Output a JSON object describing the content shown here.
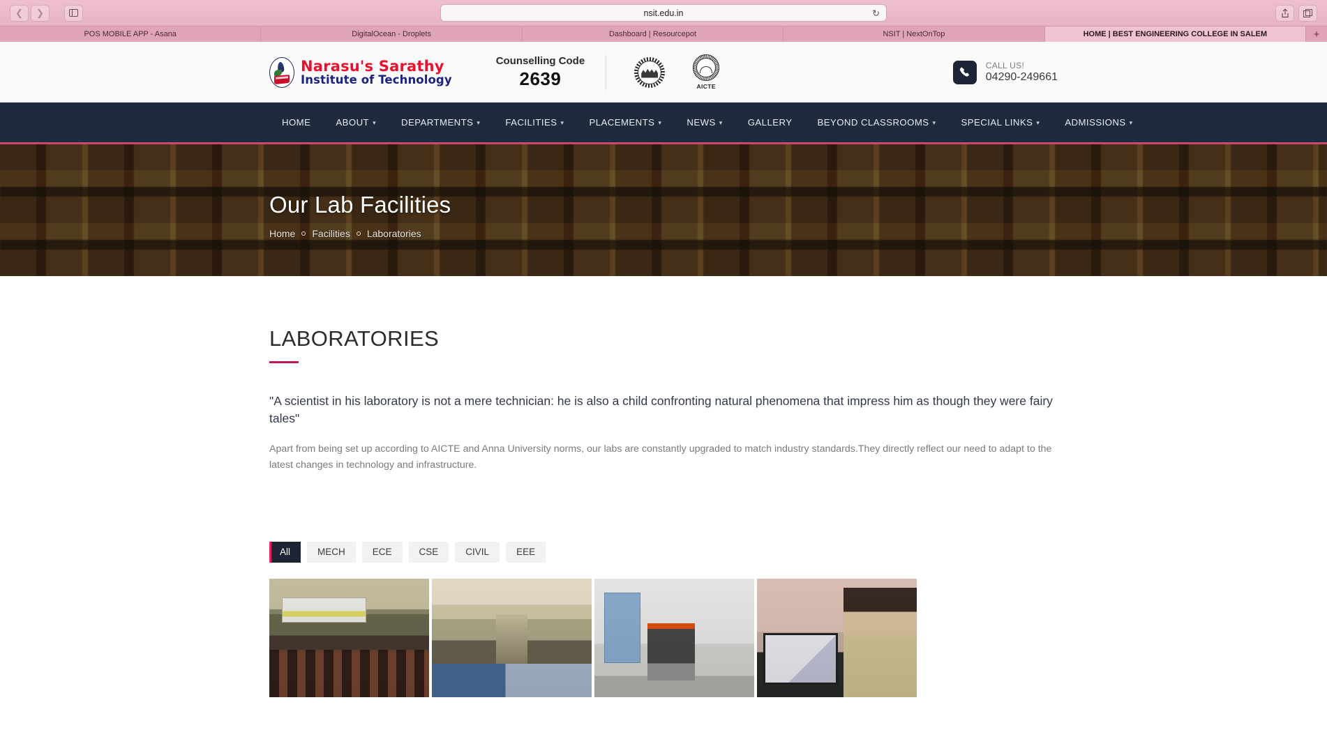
{
  "browser": {
    "url": "nsit.edu.in",
    "back_icon": "chevron-left-icon",
    "forward_icon": "chevron-right-icon",
    "sidebar_icon": "sidebar-toggle-icon",
    "reload_icon": "reload-icon",
    "share_icon": "share-icon",
    "tabs_icon": "new-tab-overview-icon",
    "new_tab_label": "+",
    "tabs": [
      {
        "label": "POS MOBILE APP - Asana",
        "active": false
      },
      {
        "label": "DigitalOcean - Droplets",
        "active": false
      },
      {
        "label": "Dashboard | Resourcepot",
        "active": false
      },
      {
        "label": "NSIT | NextOnTop",
        "active": false
      },
      {
        "label": "HOME | BEST ENGINEERING COLLEGE IN SALEM",
        "active": true
      }
    ]
  },
  "header": {
    "logo": {
      "line1": "Narasu's Sarathy",
      "line2": "Institute of Technology",
      "emblem_icon": "college-emblem-icon"
    },
    "counselling": {
      "label": "Counselling Code",
      "code": "2639"
    },
    "accreditations": [
      {
        "name": "anna-university-seal-icon",
        "caption": ""
      },
      {
        "name": "aicte-seal-icon",
        "caption": "AICTE"
      }
    ],
    "call": {
      "icon": "phone-icon",
      "label": "CALL US!",
      "number": "04290-249661"
    }
  },
  "nav": {
    "items": [
      {
        "label": "HOME",
        "has_dropdown": false
      },
      {
        "label": "ABOUT",
        "has_dropdown": true
      },
      {
        "label": "DEPARTMENTS",
        "has_dropdown": true
      },
      {
        "label": "FACILITIES",
        "has_dropdown": true
      },
      {
        "label": "PLACEMENTS",
        "has_dropdown": true
      },
      {
        "label": "NEWS",
        "has_dropdown": true
      },
      {
        "label": "GALLERY",
        "has_dropdown": false
      },
      {
        "label": "BEYOND CLASSROOMS",
        "has_dropdown": true
      },
      {
        "label": "SPECIAL LINKS",
        "has_dropdown": true
      },
      {
        "label": "ADMISSIONS",
        "has_dropdown": true
      }
    ]
  },
  "hero": {
    "title": "Our Lab Facilities",
    "breadcrumb": [
      {
        "label": "Home"
      },
      {
        "label": "Facilities"
      },
      {
        "label": "Laboratories"
      }
    ]
  },
  "main": {
    "section_title": "LABORATORIES",
    "quote": "\"A scientist in his laboratory is not a mere technician: he is also a child confronting natural phenomena that impress him as though they were fairy tales\"",
    "body": "Apart from being set up according to AICTE and Anna University norms, our labs are constantly upgraded to match industry standards.They directly reflect our need to adapt to the latest changes in technology and infrastructure.",
    "filters": [
      {
        "label": "All",
        "active": true
      },
      {
        "label": "MECH",
        "active": false
      },
      {
        "label": "ECE",
        "active": false
      },
      {
        "label": "CSE",
        "active": false
      },
      {
        "label": "CIVIL",
        "active": false
      },
      {
        "label": "EEE",
        "active": false
      }
    ],
    "gallery": [
      {
        "name": "seminar-hall-audience-photo",
        "style": "photo-hall-a"
      },
      {
        "name": "auditorium-gathering-photo",
        "style": "photo-hall-b"
      },
      {
        "name": "mechanical-engine-lab-photo",
        "style": "photo-lab-mech"
      },
      {
        "name": "electronics-lab-students-photo",
        "style": "photo-lab-ece"
      }
    ]
  },
  "colors": {
    "accent_pink": "#c2185b",
    "nav_dark": "#202a3d",
    "logo_red": "#e8112d",
    "logo_blue": "#1a237e",
    "browser_chrome": "#e8b4c8"
  }
}
